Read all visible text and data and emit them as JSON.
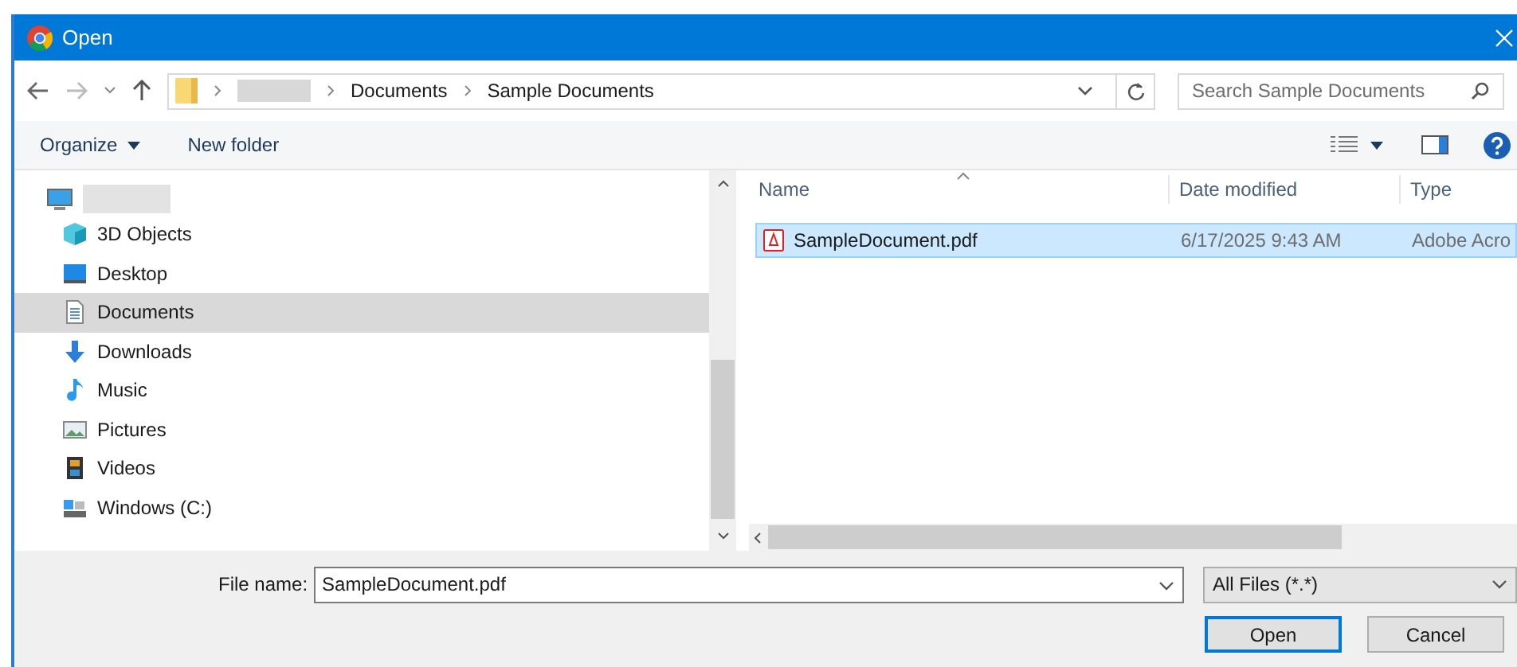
{
  "window": {
    "title": "Open"
  },
  "address": {
    "crumbs": [
      "Documents",
      "Sample Documents"
    ]
  },
  "search": {
    "placeholder": "Search Sample Documents"
  },
  "toolbar": {
    "organize": "Organize",
    "new_folder": "New folder"
  },
  "sidebar": {
    "items": [
      {
        "label": "3D Objects",
        "kind": "objects",
        "selected": false
      },
      {
        "label": "Desktop",
        "kind": "desktop",
        "selected": false
      },
      {
        "label": "Documents",
        "kind": "documents",
        "selected": true
      },
      {
        "label": "Downloads",
        "kind": "downloads",
        "selected": false
      },
      {
        "label": "Music",
        "kind": "music",
        "selected": false
      },
      {
        "label": "Pictures",
        "kind": "pictures",
        "selected": false
      },
      {
        "label": "Videos",
        "kind": "videos",
        "selected": false
      },
      {
        "label": "Windows (C:)",
        "kind": "drive",
        "selected": false
      }
    ]
  },
  "table": {
    "columns": [
      "Name",
      "Date modified",
      "Type"
    ],
    "rows": [
      {
        "name": "SampleDocument.pdf",
        "date": "6/17/2025 9:43 AM",
        "type": "Adobe Acro",
        "selected": true
      }
    ]
  },
  "file_name": {
    "label": "File name:",
    "value": "SampleDocument.pdf"
  },
  "file_type": {
    "value": "All Files (*.*)"
  },
  "buttons": [
    "Open",
    "Cancel"
  ]
}
